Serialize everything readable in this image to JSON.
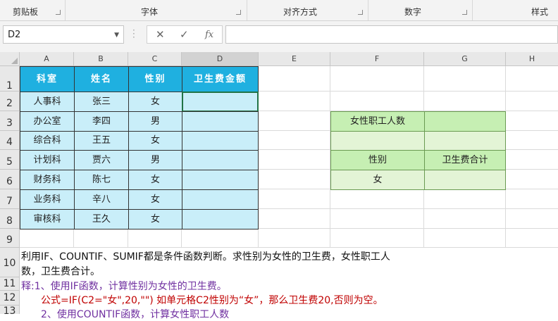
{
  "ribbon": {
    "groups": [
      "剪贴板",
      "字体",
      "对齐方式",
      "数字",
      "样式"
    ]
  },
  "formula_bar": {
    "name_box": "D2",
    "fx_label": "fx",
    "content": ""
  },
  "columns": [
    "A",
    "B",
    "C",
    "D",
    "E",
    "F",
    "G",
    "H"
  ],
  "rows": [
    "1",
    "2",
    "3",
    "4",
    "5",
    "6",
    "7",
    "8",
    "9",
    "10",
    "11",
    "12",
    "13"
  ],
  "table": {
    "headers": [
      "科室",
      "姓名",
      "性别",
      "卫生费金额"
    ],
    "rows": [
      [
        "人事科",
        "张三",
        "女",
        ""
      ],
      [
        "办公室",
        "李四",
        "男",
        ""
      ],
      [
        "综合科",
        "王五",
        "女",
        ""
      ],
      [
        "计划科",
        "贾六",
        "男",
        ""
      ],
      [
        "财务科",
        "陈七",
        "女",
        ""
      ],
      [
        "业务科",
        "辛八",
        "女",
        ""
      ],
      [
        "审核科",
        "王久",
        "女",
        ""
      ]
    ]
  },
  "summary": {
    "female_count_label": "女性职工人数",
    "female_count_value": "",
    "gender_header": "性别",
    "total_fee_header": "卫生费合计",
    "gender_value": "女",
    "total_fee_value": ""
  },
  "notes": {
    "line1": "利用IF、COUNTIF、SUMIF都是条件函数判断。求性别为女性的卫生费，女性职工人",
    "line2": "数，卫生费合计。",
    "line3": "释:1、使用IF函数，计算性别为女性的卫生费。",
    "line4": "公式=IF(C2=\"女\",20,\"\")  如单元格C2性别为“女”，那么卫生费20,否则为空。",
    "line5": "2、使用COUNTIF函数，计算女性职工人数"
  },
  "colors": {
    "header_blue": "#1fb0e0",
    "data_blue": "#c9eef9",
    "summary_green": "#c6efb3",
    "summary_light_green": "#e3f4d6",
    "note_purple": "#7030a0",
    "note_red": "#c00000"
  }
}
